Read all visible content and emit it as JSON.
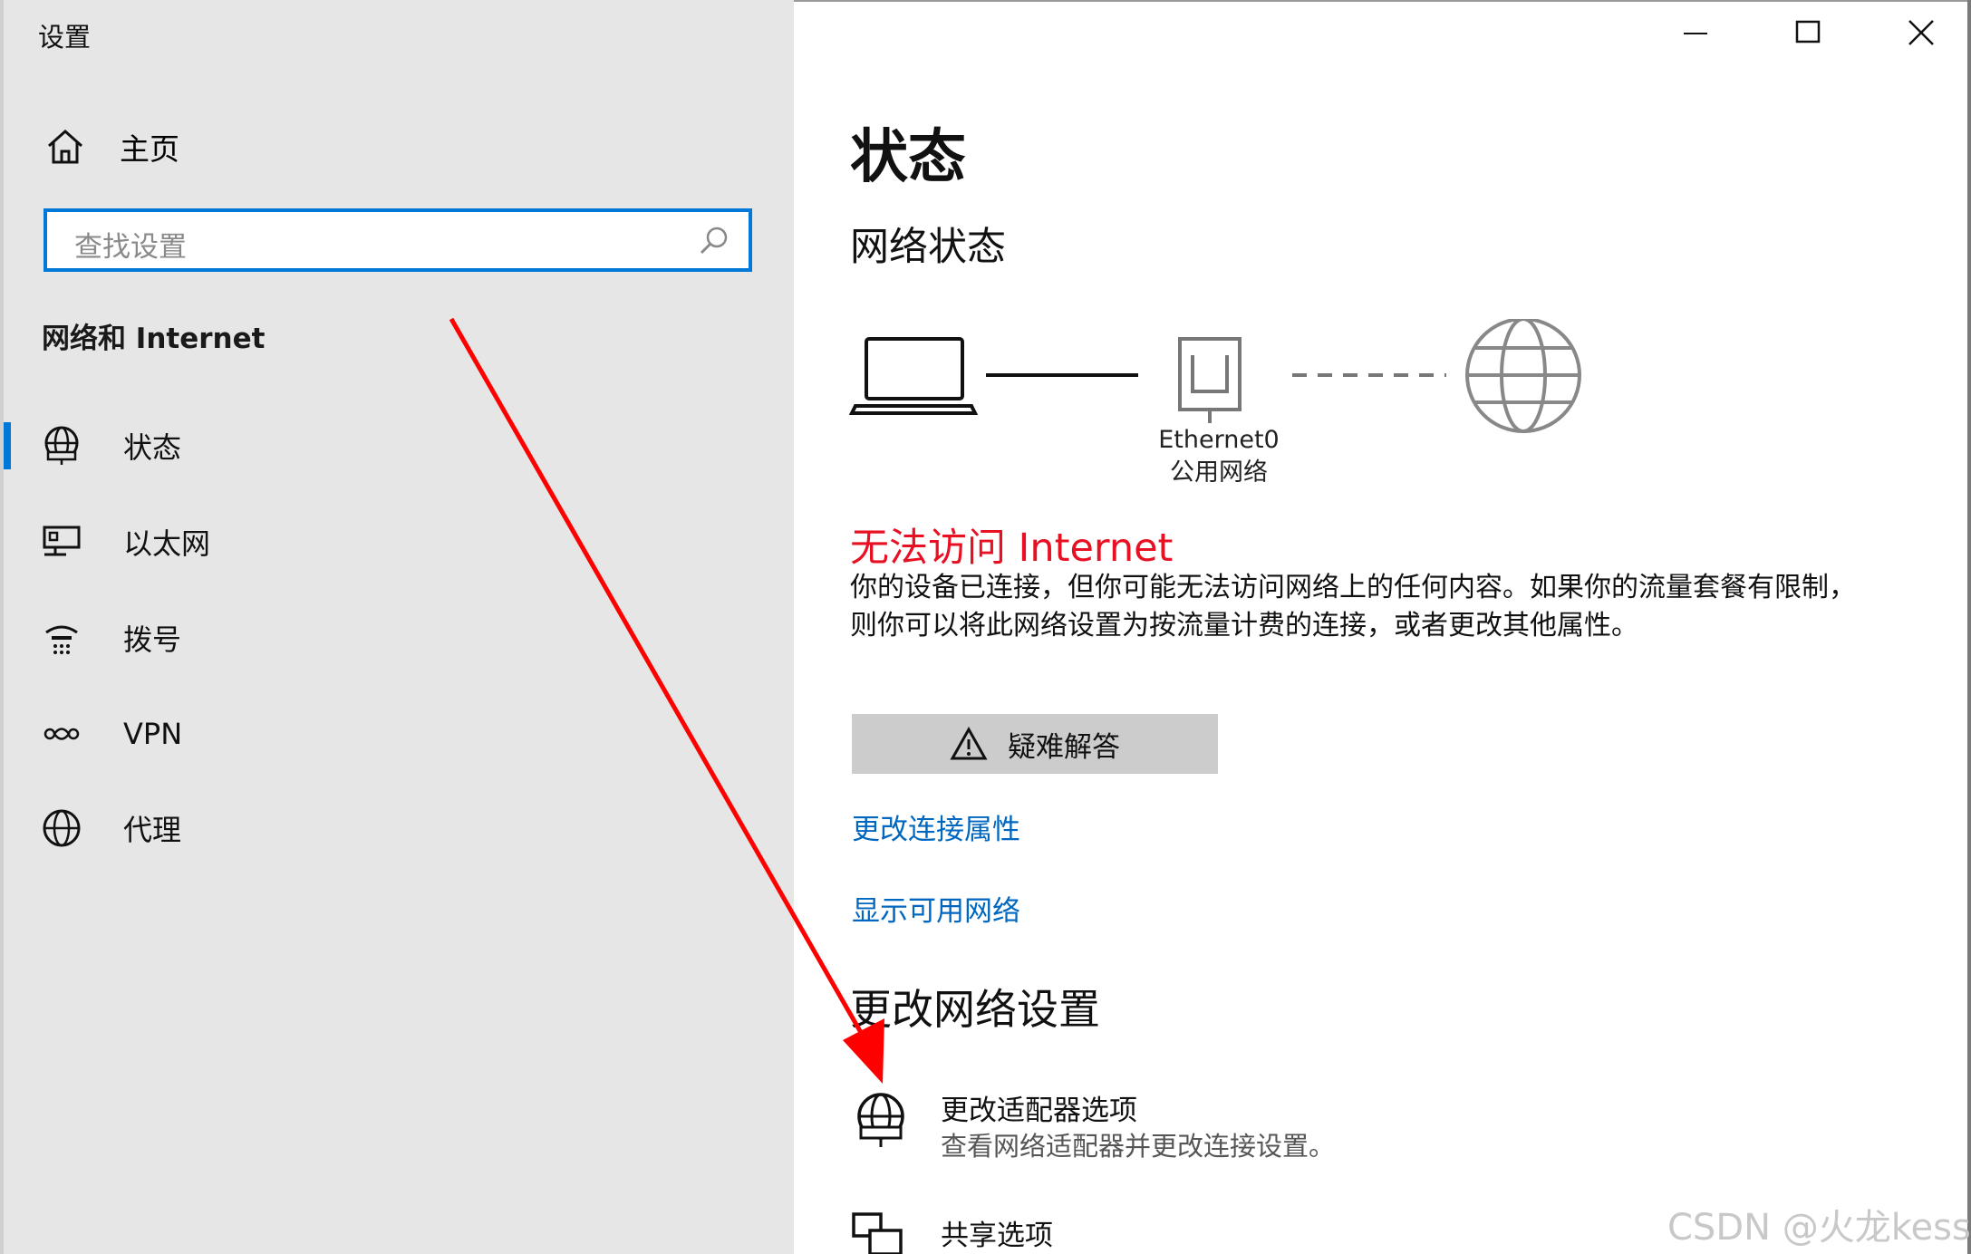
{
  "window": {
    "title": "设置",
    "minimize_icon": "minimize-icon",
    "maximize_icon": "maximize-icon",
    "close_icon": "close-icon"
  },
  "sidebar": {
    "home_label": "主页",
    "search_placeholder": "查找设置",
    "section_title": "网络和 Internet",
    "items": [
      {
        "label": "状态",
        "icon": "globe-status-icon",
        "selected": true
      },
      {
        "label": "以太网",
        "icon": "ethernet-icon",
        "selected": false
      },
      {
        "label": "拨号",
        "icon": "dialup-icon",
        "selected": false
      },
      {
        "label": "VPN",
        "icon": "vpn-icon",
        "selected": false
      },
      {
        "label": "代理",
        "icon": "globe-icon",
        "selected": false
      }
    ]
  },
  "main": {
    "page_title": "状态",
    "network_status_title": "网络状态",
    "diagram": {
      "adapter_name": "Ethernet0",
      "network_type": "公用网络"
    },
    "error_title": "无法访问 Internet",
    "error_description": "你的设备已连接，但你可能无法访问网络上的任何内容。如果你的流量套餐有限制，则你可以将此网络设置为按流量计费的连接，或者更改其他属性。",
    "troubleshoot_label": "疑难解答",
    "links": {
      "change_properties": "更改连接属性",
      "show_networks": "显示可用网络"
    },
    "change_settings_title": "更改网络设置",
    "options": [
      {
        "title": "更改适配器选项",
        "desc": "查看网络适配器并更改连接设置。"
      },
      {
        "title": "共享选项",
        "desc": ""
      }
    ]
  },
  "watermark": "CSDN @火龙kess",
  "colors": {
    "accent": "#0078d7",
    "link": "#0067c0",
    "error": "#e81123",
    "sidebar_bg": "#e6e6e6",
    "annotation_arrow": "#ff0000"
  }
}
